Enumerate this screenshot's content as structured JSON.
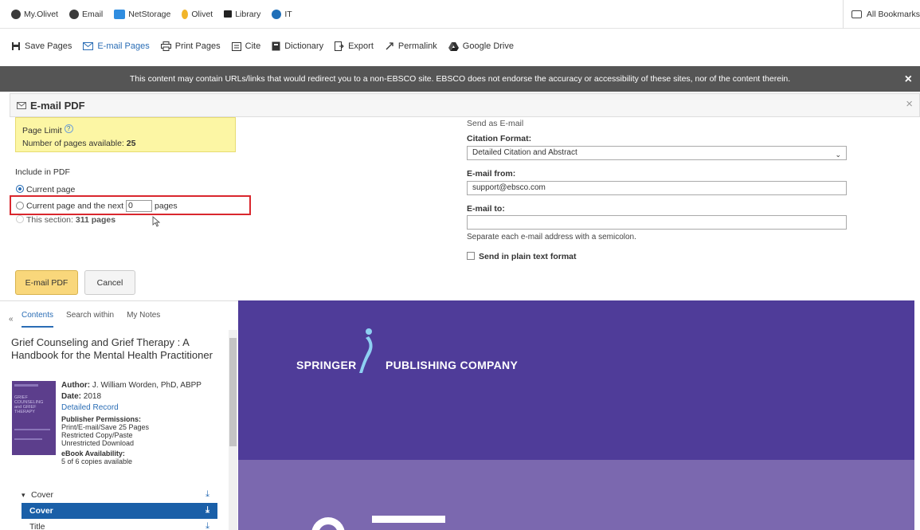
{
  "bookmarks": {
    "items": [
      "My.Olivet",
      "Email",
      "NetStorage",
      "Olivet",
      "Library",
      "IT"
    ],
    "right_label": "All Bookmarks"
  },
  "toolbar": {
    "items": [
      "Save Pages",
      "E-mail Pages",
      "Print Pages",
      "Cite",
      "Dictionary",
      "Export",
      "Permalink",
      "Google Drive"
    ],
    "active": "E-mail Pages"
  },
  "banner": {
    "text": "This content may contain URLs/links that would redirect you to a non-EBSCO site. EBSCO does not endorse the accuracy or accessibility of these sites, nor of the content therein.",
    "close": "×"
  },
  "panel": {
    "title": "E-mail PDF",
    "close": "×",
    "page_limit_label": "Page Limit",
    "page_limit_help": "?",
    "pages_available_label": "Number of pages available:",
    "pages_available_value": "25",
    "include_label": "Include in PDF",
    "option_current": "Current page",
    "option_next_prefix": "Current page and the next",
    "option_next_value": "0",
    "option_next_suffix": "pages",
    "option_section_prefix": "This section:",
    "option_section_value": "311 pages",
    "send_as_label": "Send as E-mail",
    "citation_label": "Citation Format:",
    "citation_value": "Detailed Citation and Abstract",
    "email_from_label": "E-mail from:",
    "email_from_value": "support@ebsco.com",
    "email_to_label": "E-mail to:",
    "email_to_value": "",
    "email_to_hint": "Separate each e-mail address with a semicolon.",
    "plain_text_label": "Send in plain text format",
    "primary_button": "E-mail PDF",
    "cancel_button": "Cancel"
  },
  "sidebar": {
    "collapse": "«",
    "tabs": [
      "Contents",
      "Search within",
      "My Notes"
    ],
    "active_tab": "Contents",
    "book_title": "Grief Counseling and Grief Therapy : A Handbook for the Mental Health Practitioner",
    "author_label": "Author:",
    "author_value": "J. William Worden, PhD, ABPP",
    "date_label": "Date:",
    "date_value": "2018",
    "detailed_record": "Detailed Record",
    "permissions_label": "Publisher Permissions:",
    "permissions_lines": [
      "Print/E-mail/Save 25 Pages",
      "Restricted Copy/Paste",
      "Unrestricted Download"
    ],
    "availability_label": "eBook Availability:",
    "availability_value": "5 of 6 copies available",
    "cover_thumb_lines": [
      "GRIEF",
      "COUNSELING",
      "and GRIEF",
      "THERAPY"
    ],
    "toc": [
      {
        "label": "Cover",
        "expander": "▾",
        "selected": false
      },
      {
        "label": "Cover",
        "expander": "",
        "selected": true
      },
      {
        "label": "Title",
        "expander": "",
        "selected": false
      }
    ]
  },
  "preview": {
    "publisher_left": "SPRINGER",
    "publisher_right": "PUBLISHING COMPANY"
  },
  "colors": {
    "accent": "#2a6db5",
    "highlight_border": "#d9272e",
    "page_limit_bg": "#fcf6a4",
    "primary_button": "#f9d77b",
    "banner_bg": "#555555",
    "preview_top": "#4f3c99",
    "preview_bottom": "#7b68af",
    "toc_selected": "#1a5fa8"
  }
}
